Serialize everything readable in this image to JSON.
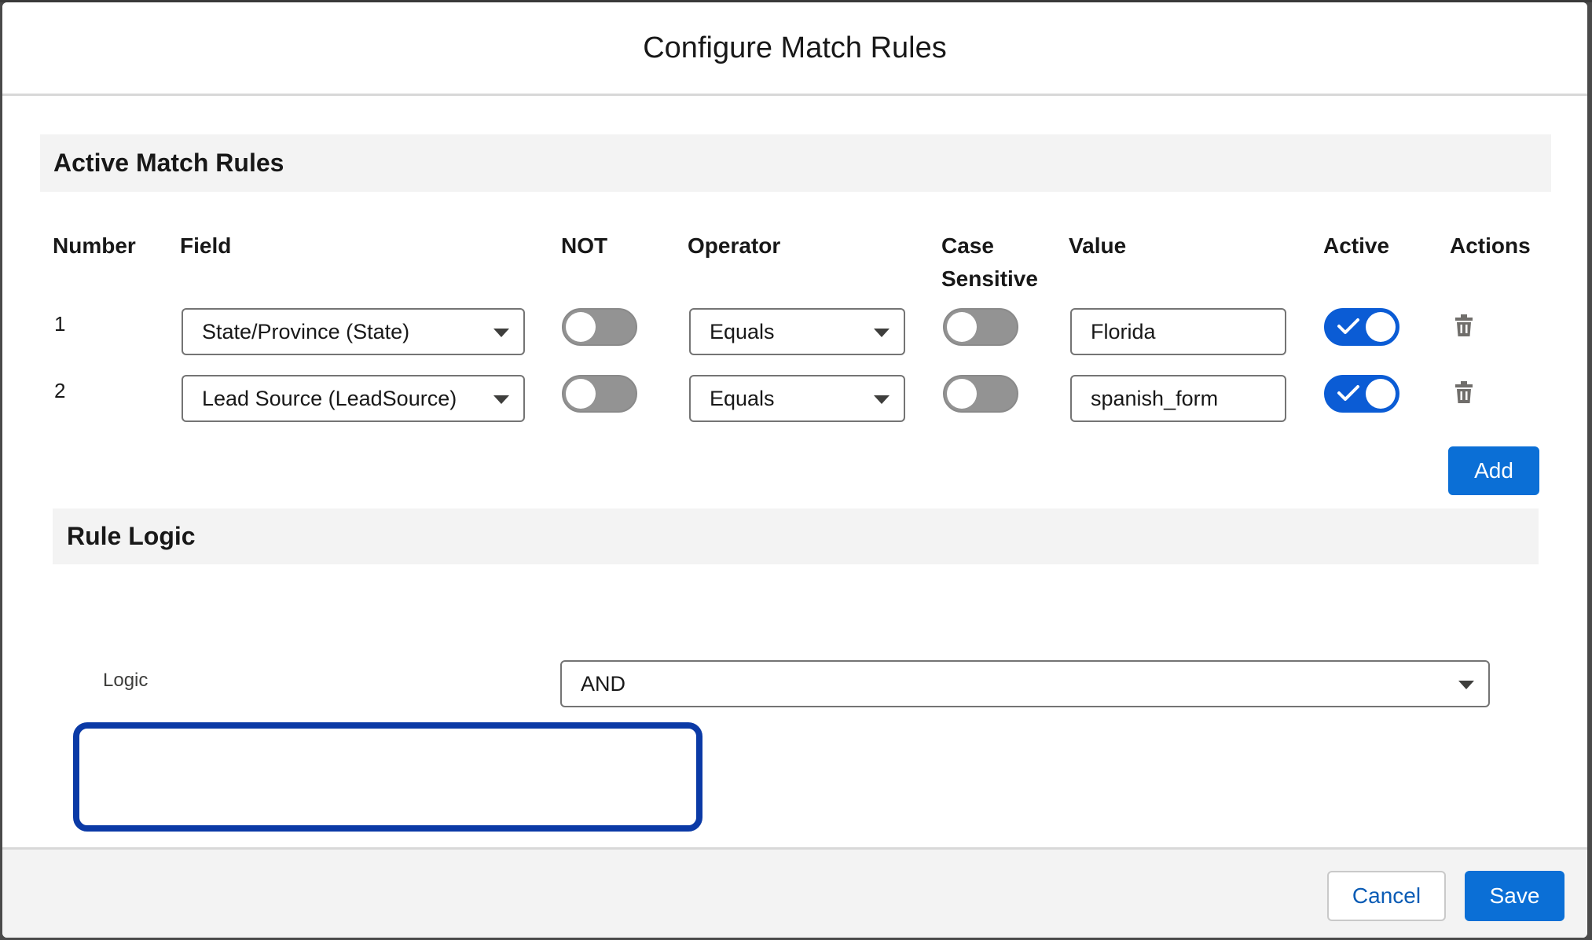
{
  "modal": {
    "title": "Configure Match Rules"
  },
  "active_rules": {
    "section_title": "Active Match Rules",
    "columns": {
      "number": "Number",
      "field": "Field",
      "not": "NOT",
      "operator": "Operator",
      "case_sensitive_line1": "Case",
      "case_sensitive_line2": "Sensitive",
      "value": "Value",
      "active": "Active",
      "actions": "Actions"
    },
    "rows": [
      {
        "number": "1",
        "field": "State/Province (State)",
        "not": false,
        "operator": "Equals",
        "case_sensitive": false,
        "value": "Florida",
        "active": true,
        "action_icon": "trash-icon"
      },
      {
        "number": "2",
        "field": "Lead Source (LeadSource)",
        "not": false,
        "operator": "Equals",
        "case_sensitive": false,
        "value": "spanish_form",
        "active": true,
        "action_icon": "trash-icon"
      }
    ],
    "add_label": "Add"
  },
  "rule_logic": {
    "section_title": "Rule Logic",
    "logic_label": "Logic",
    "logic_value": "AND"
  },
  "footer": {
    "cancel_label": "Cancel",
    "save_label": "Save"
  },
  "colors": {
    "brand": "#0b6fd6",
    "toggle_on": "#0b5cd5",
    "toggle_off": "#939393",
    "focus_ring": "#0b3aa6",
    "section_bg": "#f3f3f3"
  }
}
